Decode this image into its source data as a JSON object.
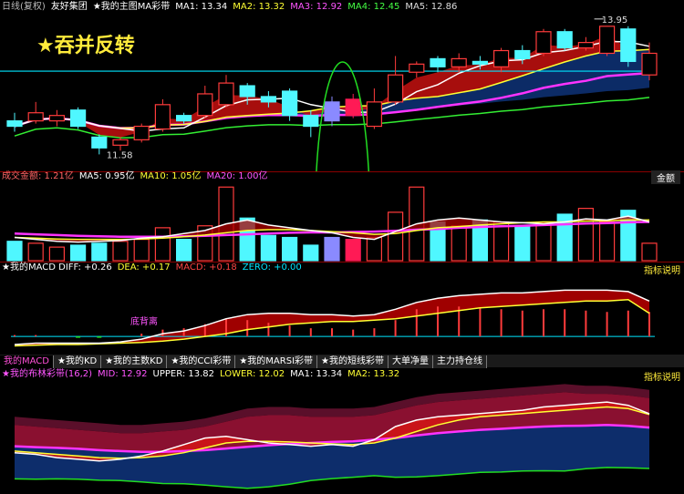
{
  "header": {
    "main_items": [
      {
        "label": "日线(复权)",
        "color": "#bbbbbb"
      },
      {
        "label": "友好集团",
        "color": "#ffffff"
      },
      {
        "label": "★我的主图MA彩带",
        "color": "#ffffff"
      },
      {
        "label": "MA1: 13.34",
        "color": "#ffffff"
      },
      {
        "label": "MA2: 13.32",
        "color": "#ffff33"
      },
      {
        "label": "MA3: 12.92",
        "color": "#ff55ff"
      },
      {
        "label": "MA4: 12.45",
        "color": "#44ff44"
      },
      {
        "label": "MA5: 12.86",
        "color": "#dddddd"
      }
    ],
    "caption": "★吞并反转",
    "vol_items": [
      {
        "label": "成交金额: 1.21亿",
        "color": "#ff6666"
      },
      {
        "label": "MA5: 0.95亿",
        "color": "#ffffff"
      },
      {
        "label": "MA10: 1.05亿",
        "color": "#ffff33"
      },
      {
        "label": "MA20: 1.00亿",
        "color": "#ff55ff"
      }
    ],
    "vol_button": "金额",
    "macd_items": [
      {
        "label": "★我的MACD DIFF: +0.26",
        "color": "#ffffff"
      },
      {
        "label": "DEA: +0.17",
        "color": "#ffff33"
      },
      {
        "label": "MACD: +0.18",
        "color": "#ff4444"
      },
      {
        "label": "ZERO: +0.00",
        "color": "#00e5ff"
      }
    ],
    "macd_button": "指标说明",
    "macd_annotation": "底背离",
    "boll_items": [
      {
        "label": "★我的布林彩带(16,2)",
        "color": "#ff55ff"
      },
      {
        "label": "MID: 12.92",
        "color": "#ff55ff"
      },
      {
        "label": "UPPER: 13.82",
        "color": "#ffffff"
      },
      {
        "label": "LOWER: 12.02",
        "color": "#ffff33"
      },
      {
        "label": "MA1: 13.34",
        "color": "#ffffff"
      },
      {
        "label": "MA2: 13.32",
        "color": "#ffff33"
      }
    ],
    "boll_button": "指标说明"
  },
  "tabs": [
    "我的MACD",
    "★我的KD",
    "★我的主数KD",
    "★我的CCI彩带",
    "★我的MARSI彩带",
    "★我的短线彩带",
    "大单净量",
    "主力持仓线"
  ],
  "chart_data": [
    {
      "type": "candlestick",
      "title": "★我的主图MA彩带",
      "high_label": "13.95",
      "low_label": "11.58",
      "ylim": [
        11.3,
        14.2
      ],
      "candles": [
        {
          "o": 12.2,
          "c": 12.1,
          "h": 12.35,
          "l": 12.0
        },
        {
          "o": 12.2,
          "c": 12.35,
          "h": 12.55,
          "l": 12.15
        },
        {
          "o": 12.2,
          "c": 12.3,
          "h": 12.4,
          "l": 12.1
        },
        {
          "o": 12.4,
          "c": 12.1,
          "h": 12.45,
          "l": 12.05
        },
        {
          "o": 11.9,
          "c": 11.7,
          "h": 11.95,
          "l": 11.58
        },
        {
          "o": 11.75,
          "c": 11.85,
          "h": 11.9,
          "l": 11.65
        },
        {
          "o": 11.85,
          "c": 12.1,
          "h": 12.15,
          "l": 11.8
        },
        {
          "o": 12.05,
          "c": 12.5,
          "h": 12.6,
          "l": 12.0
        },
        {
          "o": 12.3,
          "c": 12.2,
          "h": 12.35,
          "l": 12.15
        },
        {
          "o": 12.3,
          "c": 12.7,
          "h": 12.85,
          "l": 12.25
        },
        {
          "o": 12.5,
          "c": 12.9,
          "h": 13.05,
          "l": 12.45
        },
        {
          "o": 12.85,
          "c": 12.65,
          "h": 12.9,
          "l": 12.5
        },
        {
          "o": 12.65,
          "c": 12.55,
          "h": 12.75,
          "l": 12.45
        },
        {
          "o": 12.75,
          "c": 12.3,
          "h": 12.8,
          "l": 12.2
        },
        {
          "o": 12.3,
          "c": 12.1,
          "h": 12.4,
          "l": 11.9
        },
        {
          "o": 12.2,
          "c": 12.55,
          "h": 12.65,
          "l": 12.1
        },
        {
          "o": 12.6,
          "c": 12.3,
          "h": 12.7,
          "l": 12.25
        },
        {
          "o": 12.1,
          "c": 12.55,
          "h": 12.8,
          "l": 12.05
        },
        {
          "o": 12.55,
          "c": 13.05,
          "h": 13.4,
          "l": 12.5
        },
        {
          "o": 13.1,
          "c": 13.25,
          "h": 13.3,
          "l": 13.0
        },
        {
          "o": 13.35,
          "c": 13.2,
          "h": 13.4,
          "l": 13.1
        },
        {
          "o": 13.2,
          "c": 13.35,
          "h": 13.45,
          "l": 13.1
        },
        {
          "o": 13.3,
          "c": 13.25,
          "h": 13.4,
          "l": 13.15
        },
        {
          "o": 13.2,
          "c": 13.5,
          "h": 13.55,
          "l": 13.1
        },
        {
          "o": 13.5,
          "c": 13.35,
          "h": 13.6,
          "l": 13.25
        },
        {
          "o": 13.45,
          "c": 13.85,
          "h": 13.9,
          "l": 13.4
        },
        {
          "o": 13.85,
          "c": 13.55,
          "h": 13.9,
          "l": 13.5
        },
        {
          "o": 13.55,
          "c": 13.65,
          "h": 13.75,
          "l": 13.5
        },
        {
          "o": 13.45,
          "c": 13.95,
          "h": 13.95,
          "l": 13.4
        },
        {
          "o": 13.9,
          "c": 13.3,
          "h": 13.95,
          "l": 13.2
        },
        {
          "o": 13.05,
          "c": 13.45,
          "h": 13.65,
          "l": 12.95
        }
      ]
    },
    {
      "type": "bar",
      "title": "成交金额",
      "unit": "亿",
      "ylim": [
        0,
        2.0
      ],
      "values": [
        0.5,
        0.45,
        0.35,
        0.4,
        0.45,
        0.5,
        0.55,
        0.85,
        0.55,
        0.9,
        1.9,
        1.1,
        0.65,
        0.6,
        0.4,
        0.6,
        0.55,
        0.6,
        1.25,
        1.9,
        1.0,
        0.9,
        1.05,
        1.0,
        0.9,
        0.95,
        1.2,
        1.35,
        1.0,
        1.3,
        0.45
      ],
      "ma5": [
        0.6,
        0.55,
        0.5,
        0.48,
        0.5,
        0.52,
        0.58,
        0.62,
        0.7,
        0.78,
        0.95,
        1.05,
        0.92,
        0.85,
        0.78,
        0.72,
        0.6,
        0.55,
        0.75,
        0.95,
        1.05,
        1.1,
        1.05,
        1.0,
        0.98,
        0.95,
        1.0,
        1.08,
        1.05,
        1.15,
        1.0
      ],
      "ma10": [
        0.6,
        0.58,
        0.56,
        0.55,
        0.55,
        0.55,
        0.56,
        0.58,
        0.62,
        0.66,
        0.72,
        0.78,
        0.8,
        0.8,
        0.78,
        0.75,
        0.72,
        0.68,
        0.7,
        0.78,
        0.85,
        0.88,
        0.92,
        0.95,
        0.98,
        1.0,
        1.0,
        1.02,
        1.03,
        1.05,
        1.05
      ],
      "ma20": [
        0.7,
        0.68,
        0.66,
        0.64,
        0.63,
        0.62,
        0.62,
        0.62,
        0.63,
        0.64,
        0.66,
        0.68,
        0.7,
        0.72,
        0.73,
        0.73,
        0.74,
        0.75,
        0.77,
        0.8,
        0.82,
        0.85,
        0.87,
        0.89,
        0.9,
        0.92,
        0.94,
        0.96,
        0.97,
        0.99,
        1.0
      ]
    },
    {
      "type": "bar",
      "title": "★我的MACD",
      "ylim": [
        -0.1,
        0.45
      ],
      "macd": [
        0.01,
        0.01,
        0.0,
        -0.01,
        -0.01,
        0.0,
        0.02,
        0.05,
        0.06,
        0.09,
        0.13,
        0.12,
        0.1,
        0.08,
        0.06,
        0.06,
        0.05,
        0.06,
        0.12,
        0.2,
        0.22,
        0.22,
        0.21,
        0.2,
        0.19,
        0.2,
        0.2,
        0.19,
        0.18,
        0.19,
        0.18
      ],
      "diff": [
        -0.06,
        -0.05,
        -0.05,
        -0.05,
        -0.05,
        -0.04,
        -0.02,
        0.02,
        0.04,
        0.08,
        0.13,
        0.16,
        0.17,
        0.17,
        0.16,
        0.16,
        0.15,
        0.16,
        0.2,
        0.25,
        0.28,
        0.3,
        0.31,
        0.32,
        0.32,
        0.33,
        0.34,
        0.34,
        0.34,
        0.33,
        0.26
      ],
      "dea": [
        -0.07,
        -0.065,
        -0.06,
        -0.06,
        -0.055,
        -0.05,
        -0.045,
        -0.035,
        -0.02,
        0.0,
        0.02,
        0.05,
        0.07,
        0.09,
        0.1,
        0.11,
        0.11,
        0.12,
        0.13,
        0.15,
        0.17,
        0.19,
        0.21,
        0.22,
        0.23,
        0.24,
        0.25,
        0.26,
        0.26,
        0.27,
        0.17
      ]
    },
    {
      "type": "area",
      "title": "★我的布林彩带(16,2)",
      "ylim": [
        11.0,
        14.4
      ],
      "upper": [
        13.0,
        12.95,
        12.9,
        12.85,
        12.8,
        12.75,
        12.75,
        12.8,
        12.85,
        12.95,
        13.1,
        13.25,
        13.3,
        13.3,
        13.25,
        13.25,
        13.25,
        13.3,
        13.45,
        13.6,
        13.7,
        13.75,
        13.8,
        13.85,
        13.9,
        13.95,
        14.0,
        13.95,
        13.95,
        13.9,
        13.82
      ],
      "mid": [
        12.35,
        12.32,
        12.3,
        12.27,
        12.23,
        12.2,
        12.18,
        12.18,
        12.2,
        12.23,
        12.28,
        12.33,
        12.38,
        12.42,
        12.45,
        12.48,
        12.5,
        12.55,
        12.6,
        12.68,
        12.75,
        12.8,
        12.85,
        12.88,
        12.92,
        12.95,
        12.97,
        12.98,
        13.0,
        12.97,
        12.92
      ],
      "lower": [
        11.7,
        11.69,
        11.7,
        11.69,
        11.66,
        11.65,
        11.61,
        11.56,
        11.55,
        11.51,
        11.46,
        11.41,
        11.46,
        11.54,
        11.65,
        11.71,
        11.75,
        11.8,
        11.75,
        11.76,
        11.8,
        11.85,
        11.9,
        11.91,
        11.94,
        11.95,
        11.94,
        12.01,
        12.05,
        12.04,
        12.02
      ],
      "ma1": [
        12.15,
        12.1,
        12.0,
        11.95,
        11.9,
        11.95,
        12.05,
        12.2,
        12.4,
        12.6,
        12.65,
        12.55,
        12.45,
        12.4,
        12.35,
        12.4,
        12.35,
        12.55,
        12.95,
        13.15,
        13.25,
        13.3,
        13.35,
        13.4,
        13.45,
        13.55,
        13.6,
        13.65,
        13.7,
        13.6,
        13.34
      ],
      "ma2": [
        12.2,
        12.15,
        12.1,
        12.05,
        12.0,
        11.98,
        12.0,
        12.05,
        12.15,
        12.3,
        12.45,
        12.5,
        12.5,
        12.48,
        12.45,
        12.42,
        12.4,
        12.45,
        12.6,
        12.8,
        13.0,
        13.15,
        13.25,
        13.3,
        13.35,
        13.4,
        13.45,
        13.5,
        13.55,
        13.5,
        13.32
      ]
    }
  ]
}
